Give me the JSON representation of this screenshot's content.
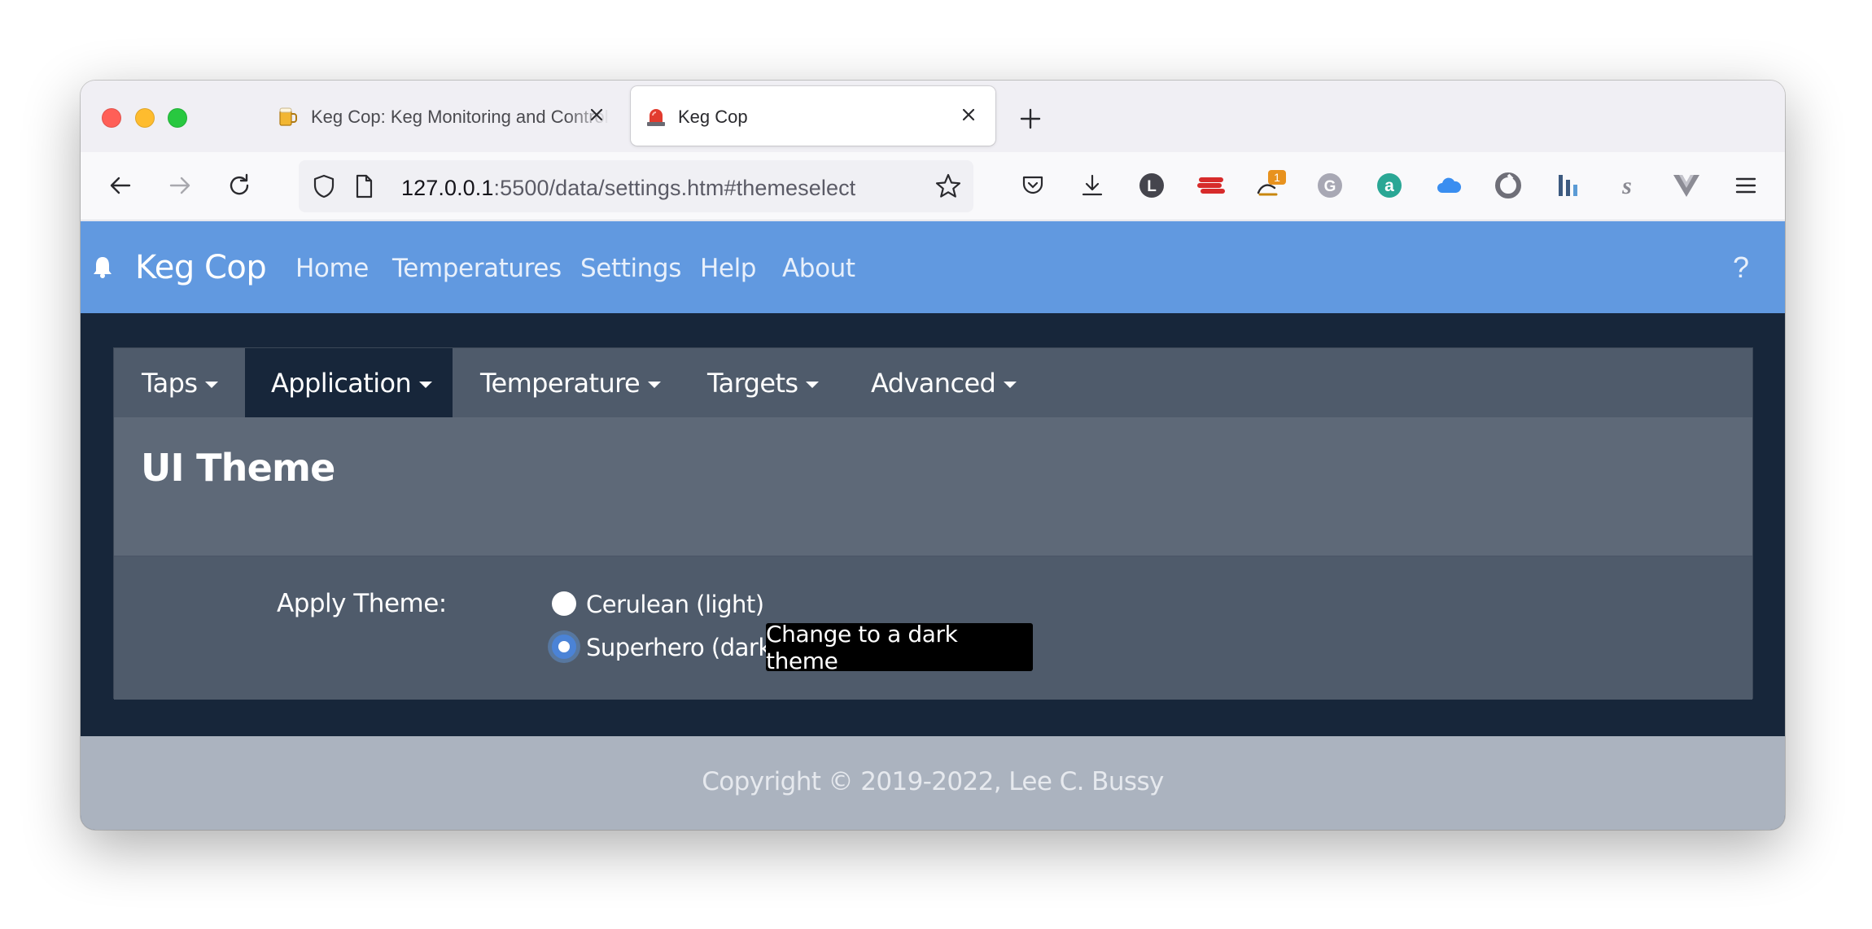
{
  "browser": {
    "tabs": [
      {
        "title": "Keg Cop: Keg Monitoring and Control",
        "active": false
      },
      {
        "title": "Keg Cop",
        "active": true
      }
    ],
    "url_host": "127.0.0.1",
    "url_rest": ":5500/data/settings.htm#themeselect",
    "toolbar_icons": [
      "back-icon",
      "forward-icon",
      "reload-icon",
      "shield-icon",
      "page-icon",
      "bookmark-star-icon",
      "pocket-icon",
      "download-icon",
      "account-l-icon",
      "extension-red-icon",
      "extension-badge-icon",
      "grammarly-icon",
      "extension-a-icon",
      "cloud-icon",
      "extension-circle-icon",
      "extension-bars-icon",
      "extension-s-icon",
      "vue-icon",
      "menu-icon"
    ],
    "badge_count": "1"
  },
  "navbar": {
    "brand": "Keg Cop",
    "links": [
      "Home",
      "Temperatures",
      "Settings",
      "Help",
      "About"
    ],
    "help": "?"
  },
  "settings": {
    "tabs": [
      "Taps",
      "Application",
      "Temperature",
      "Targets",
      "Advanced"
    ],
    "active_tab": "Application",
    "section_title": "UI Theme",
    "form_label": "Apply Theme:",
    "options": [
      "Cerulean (light)",
      "Superhero (dark)"
    ],
    "selected": "Superhero (dark)",
    "tooltip": "Change to a dark theme"
  },
  "footer": {
    "copyright": "Copyright © 2019-2022, Lee C. Bussy"
  },
  "colors": {
    "navbar": "#6199e0",
    "page_bg": "#17263a",
    "card_bg": "#4f5b6b",
    "card_header": "#5e6978",
    "footer": "#abb3bf"
  }
}
